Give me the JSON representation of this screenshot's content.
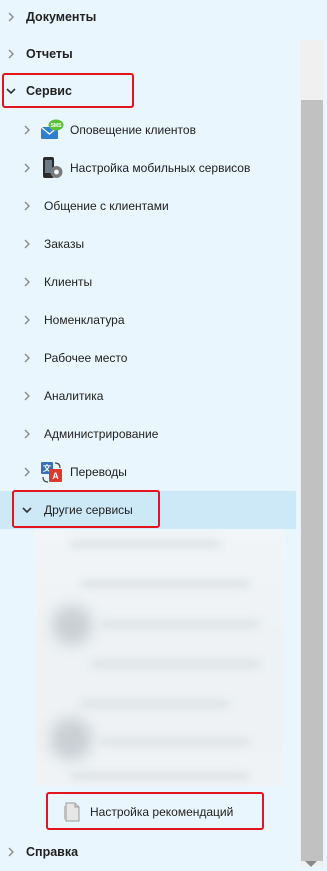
{
  "tree": {
    "top": [
      {
        "label": "Документы",
        "expanded": false
      },
      {
        "label": "Отчеты",
        "expanded": false
      },
      {
        "label": "Сервис",
        "expanded": true
      }
    ],
    "service_children": [
      {
        "label": "Оповещение клиентов",
        "icon": "sms-notification-icon"
      },
      {
        "label": "Настройка мобильных сервисов",
        "icon": "mobile-settings-icon"
      },
      {
        "label": "Общение с клиентами"
      },
      {
        "label": "Заказы"
      },
      {
        "label": "Клиенты"
      },
      {
        "label": "Номенклатура"
      },
      {
        "label": "Рабочее место"
      },
      {
        "label": "Аналитика"
      },
      {
        "label": "Администрирование"
      },
      {
        "label": "Переводы",
        "icon": "translations-icon"
      },
      {
        "label": "Другие сервисы",
        "expanded": true,
        "selected": true
      }
    ],
    "other_services_children": [
      {
        "label": "Настройка рекомендаций",
        "icon": "document-icon"
      }
    ],
    "bottom": [
      {
        "label": "Справка",
        "expanded": false
      }
    ]
  },
  "colors": {
    "background": "#e9f6fd",
    "selected_row": "#cde8f7",
    "highlight_border": "#e3141d",
    "scroll_thumb": "#c1c1c1"
  }
}
